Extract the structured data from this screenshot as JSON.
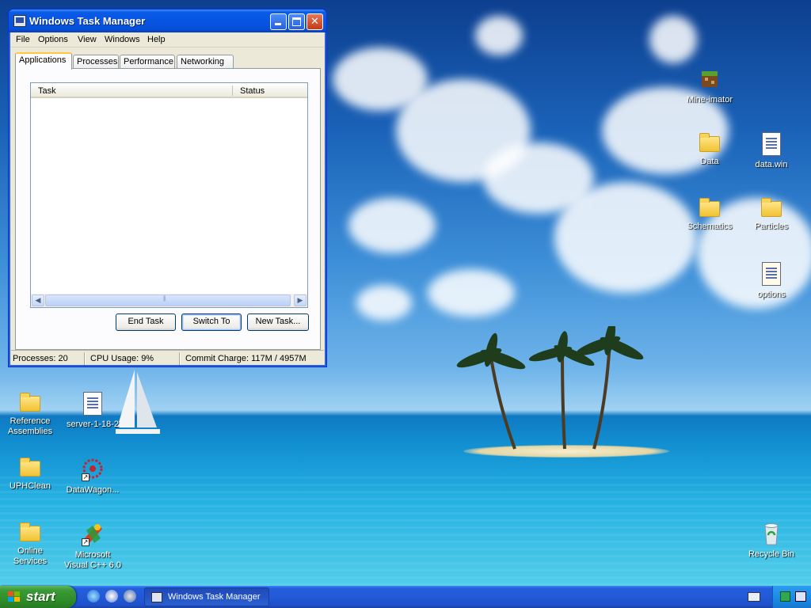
{
  "window": {
    "title": "Windows Task Manager",
    "menu": [
      "File",
      "Options",
      "View",
      "Windows",
      "Help"
    ],
    "tabs": [
      "Applications",
      "Processes",
      "Performance",
      "Networking"
    ],
    "active_tab": "Applications",
    "list_columns": [
      "Task",
      "Status"
    ],
    "buttons": {
      "end_task": "End Task",
      "switch_to": "Switch To",
      "new_task": "New Task..."
    },
    "status": {
      "processes": "Processes: 20",
      "cpu": "CPU Usage: 9%",
      "commit": "Commit Charge: 117M / 4957M"
    }
  },
  "desktop_icons": {
    "mine_imator": "Mine-imator",
    "data_folder": "Data",
    "data_win": "data.win",
    "schematics": "Schematics",
    "particles": "Particles",
    "options": "options",
    "reference_assemblies": "Reference Assemblies",
    "server": "server-1-18-2",
    "uphclean": "UPHClean",
    "datawagon": "DataWagon...",
    "online_services": "Online Services",
    "msvc": "Microsoft Visual C++ 6.0",
    "recycle_bin": "Recycle Bin"
  },
  "taskbar": {
    "start_label": "start",
    "task_button": "Windows Task Manager"
  },
  "colors": {
    "titlebar": "#0754e2",
    "taskbar": "#245edc",
    "start_button": "#3c9a36",
    "window_face": "#ece9d8"
  }
}
